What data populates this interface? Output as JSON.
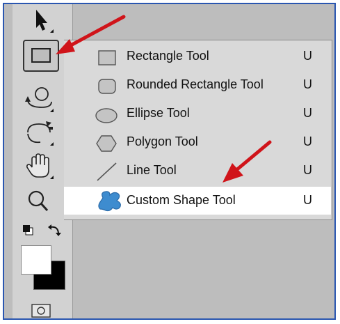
{
  "menu": {
    "items": [
      {
        "label": "Rectangle Tool",
        "shortcut": "U",
        "icon": "rectangle-icon"
      },
      {
        "label": "Rounded Rectangle Tool",
        "shortcut": "U",
        "icon": "rounded-rectangle-icon"
      },
      {
        "label": "Ellipse Tool",
        "shortcut": "U",
        "icon": "ellipse-icon"
      },
      {
        "label": "Polygon Tool",
        "shortcut": "U",
        "icon": "polygon-icon"
      },
      {
        "label": "Line Tool",
        "shortcut": "U",
        "icon": "line-icon"
      },
      {
        "label": "Custom Shape Tool",
        "shortcut": "U",
        "icon": "custom-shape-icon",
        "selected": true
      }
    ]
  },
  "toolbar": {
    "tools": [
      "move-tool-icon",
      "rectangle-tool-icon",
      "3d-rotate-icon",
      "3d-orbit-icon",
      "hand-tool-icon",
      "zoom-tool-icon"
    ],
    "default_colors_icon": "default-colors-icon",
    "swap_colors_icon": "swap-colors-icon",
    "foreground_color": "#ffffff",
    "background_color": "#000000",
    "quick_mask_icon": "quick-mask-icon"
  },
  "colors": {
    "annotation_arrow": "#d0141a",
    "frame_border": "#2a56b0",
    "custom_shape": "#3e8ccf"
  }
}
